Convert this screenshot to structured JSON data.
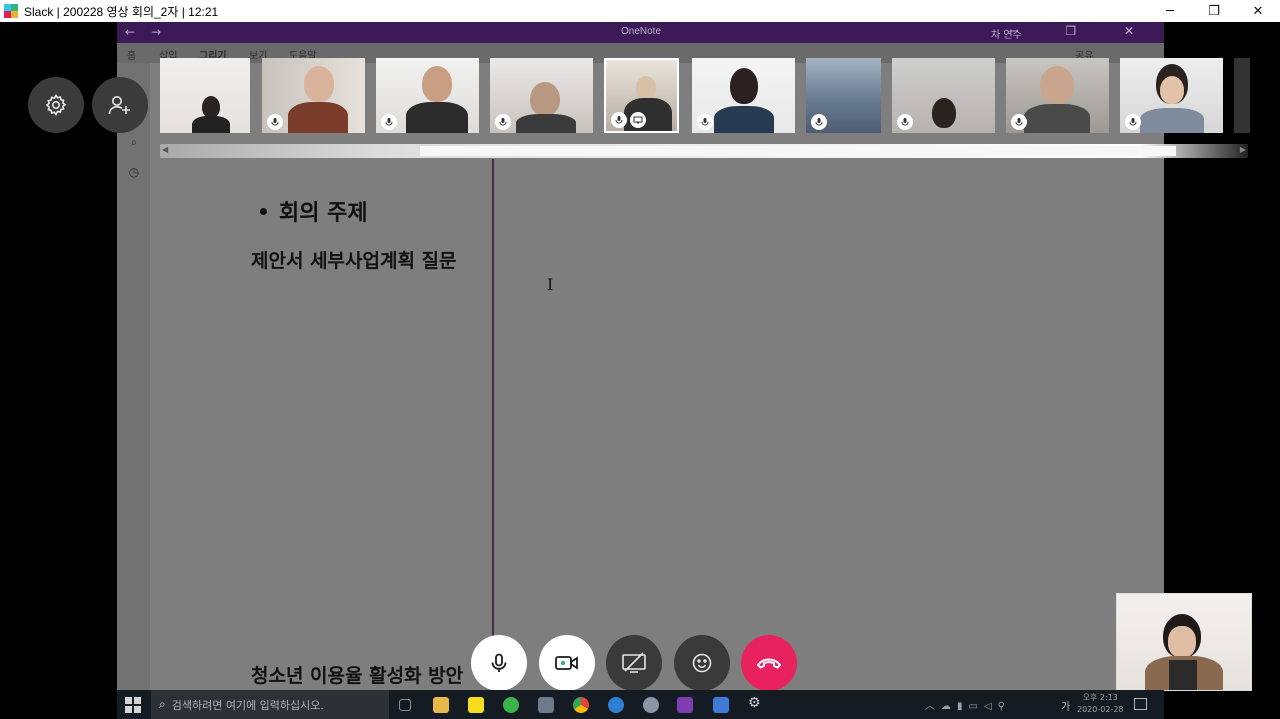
{
  "window": {
    "title": "Slack | 200228 영상 회의_2자 | 12:21",
    "minimize": "─",
    "restore": "❐",
    "close": "✕"
  },
  "onenote": {
    "app_title": "OneNote",
    "user_name": "차 연수",
    "nav_back": "←",
    "nav_forward": "→",
    "ribbon_tabs": [
      "홈",
      "삽입",
      "그리기",
      "보기",
      "도움말"
    ],
    "share_label": "공유",
    "window_buttons": "─ ❐ ✕"
  },
  "page": {
    "bullet_heading": "회의 주제",
    "note_1": "제안서 세부사업계획 질문",
    "note_2": "청소년 이용율 활성화 방안",
    "text_cursor": "I"
  },
  "participants": [
    {
      "name": "participant-1",
      "muted": true,
      "active": false
    },
    {
      "name": "participant-2",
      "muted": true,
      "active": false
    },
    {
      "name": "participant-3",
      "muted": true,
      "active": false
    },
    {
      "name": "participant-4",
      "muted": true,
      "active": false
    },
    {
      "name": "participant-5",
      "muted": true,
      "active": true,
      "sharing": true
    },
    {
      "name": "participant-6",
      "muted": true,
      "active": false
    },
    {
      "name": "participant-7",
      "muted": true,
      "active": false
    },
    {
      "name": "participant-8",
      "muted": true,
      "active": false
    },
    {
      "name": "participant-9",
      "muted": true,
      "active": false
    },
    {
      "name": "participant-10",
      "muted": true,
      "active": false
    }
  ],
  "call_controls": {
    "mic": "mic-icon",
    "video": "video-icon",
    "screen_share": "screen-share-off-icon",
    "reactions": "emoji-icon",
    "hangup": "hangup-icon",
    "hangup_color": "#e8215f"
  },
  "taskbar": {
    "search_placeholder": "검색하려면 여기에 입력하십시오.",
    "time": "오후 2:13",
    "date": "2020-02-28",
    "ime": "가"
  },
  "colors": {
    "onenote_purple": "#3c1a58",
    "hangup_red": "#e8215f"
  }
}
